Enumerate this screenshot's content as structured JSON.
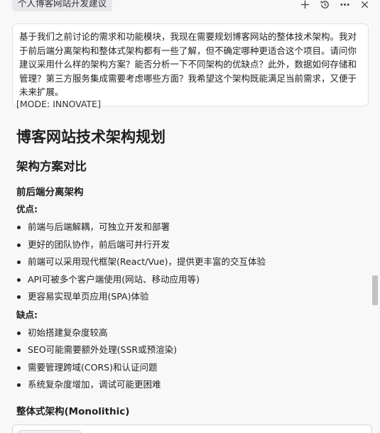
{
  "header": {
    "tab_title": "个人博客网站开发建议",
    "icons": [
      "plus-icon",
      "history-icon",
      "more-icon",
      "close-icon"
    ]
  },
  "prompt": {
    "text": "基于我们之前讨论的需求和功能模块，我现在需要规划博客网站的整体技术架构。我对于前后端分离架构和整体式架构都有一些了解，但不确定哪种更适合这个项目。请问你建议采用什么样的架构方案？能否分析一下不同架构的优缺点？此外，数据如何存储和管理？第三方服务集成需要考虑哪些方面？我希望这个架构既能满足当前需求，又便于未来扩展。"
  },
  "response": {
    "mode": "[MODE: INNOVATE]",
    "title": "博客网站技术架构规划",
    "section": "架构方案对比",
    "sub1": {
      "title": "前后端分离架构",
      "pros_label": "优点:",
      "pros": [
        "前端与后端解耦，可独立开发和部署",
        "更好的团队协作，前后端可并行开发",
        "前端可以采用现代框架(React/Vue)，提供更丰富的交互体验",
        "API可被多个客户端使用(网站、移动应用等)",
        "更容易实现单页应用(SPA)体验"
      ],
      "cons_label": "缺点:",
      "cons": [
        "初始搭建复杂度较高",
        "SEO可能需要额外处理(SSR或预渲染)",
        "需要管理跨域(CORS)和认证问题",
        "系统复杂度增加，调试可能更困难"
      ]
    },
    "sub2": {
      "title": "整体式架构(Monolithic)"
    }
  }
}
